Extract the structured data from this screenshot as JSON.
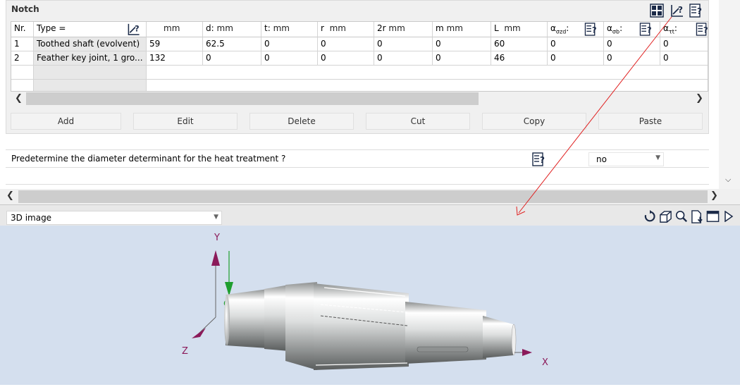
{
  "notch": {
    "title": "Notch",
    "columns": [
      {
        "label": "Nr.",
        "unit": ""
      },
      {
        "label": "Type =",
        "unit": ""
      },
      {
        "label": "",
        "unit": "mm"
      },
      {
        "label": "d:",
        "unit": "mm"
      },
      {
        "label": "t:",
        "unit": "mm"
      },
      {
        "label": "r",
        "unit": "mm"
      },
      {
        "label": "2r",
        "unit": "mm"
      },
      {
        "label": "m",
        "unit": "mm"
      },
      {
        "label": "L",
        "unit": "mm"
      },
      {
        "label": "α",
        "sub": "σzd",
        "suffix": ":",
        "unit": ""
      },
      {
        "label": "α",
        "sub": "σb",
        "suffix": ":",
        "unit": ""
      },
      {
        "label": "α",
        "sub": "τt",
        "suffix": ":",
        "unit": ""
      }
    ],
    "rows": [
      {
        "nr": "1",
        "type": "Toothed shaft (evolvent)",
        "b": "59",
        "d": "62.5",
        "t": "0",
        "r": "0",
        "r2": "0",
        "m": "0",
        "L": "60",
        "a1": "0",
        "a2": "0",
        "a3": "0"
      },
      {
        "nr": "2",
        "type": "Feather key joint, 1 gro...",
        "b": "132",
        "d": "0",
        "t": "0",
        "r": "0",
        "r2": "0",
        "m": "0",
        "L": "46",
        "a1": "0",
        "a2": "0",
        "a3": "0"
      }
    ],
    "buttons": {
      "add": "Add",
      "edit": "Edit",
      "delete": "Delete",
      "cut": "Cut",
      "copy": "Copy",
      "paste": "Paste"
    }
  },
  "questions": [
    {
      "label": "Predetermine the diameter determinant for the heat treatment ?",
      "value": "no"
    }
  ],
  "viewer": {
    "view_mode": "3D image",
    "axes": {
      "y": "Y",
      "z": "Z",
      "x": "X",
      "g": "g"
    }
  },
  "colors": {
    "panel_bg": "#f0f0f0",
    "viewer_bg": "#d4dfee",
    "axis_y": "#8b1a5a",
    "axis_g": "#1e9e2e",
    "leader_line": "#e02020",
    "shaft_mid": "#b9bcbc"
  }
}
